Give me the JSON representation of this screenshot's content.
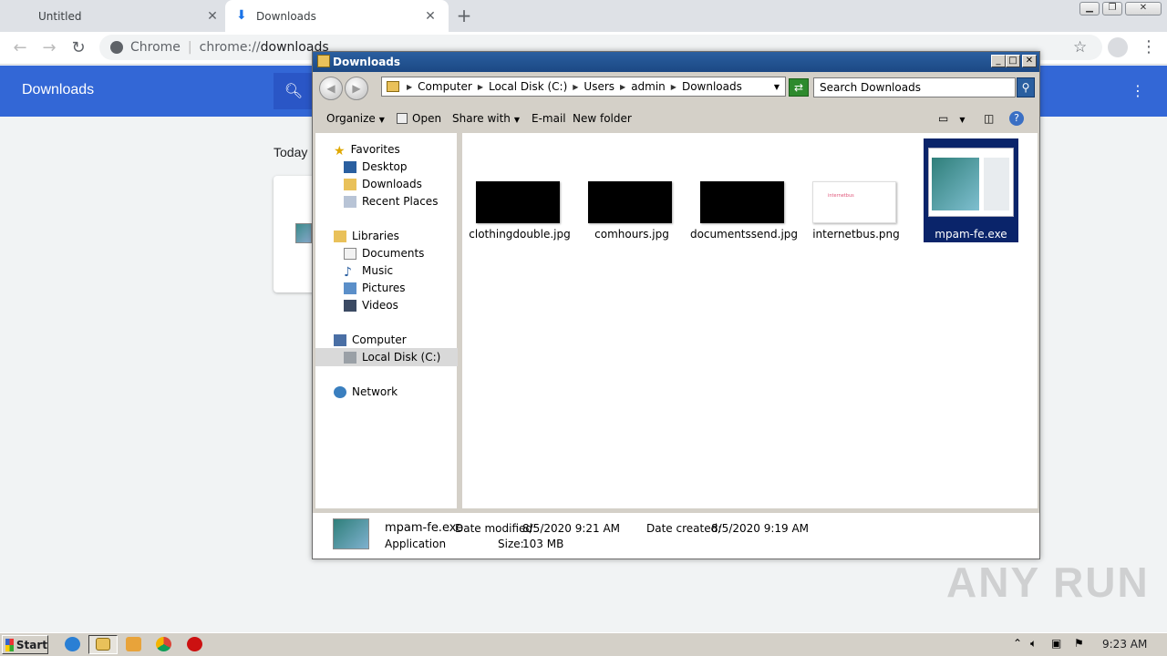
{
  "chrome": {
    "tabs": [
      {
        "title": "Untitled"
      },
      {
        "title": "Downloads"
      }
    ],
    "omnibox": {
      "chip": "Chrome",
      "url_scheme": "chrome://",
      "url_path": "downloads"
    },
    "page": {
      "header_title": "Downloads",
      "section_label": "Today"
    }
  },
  "explorer": {
    "title": "Downloads",
    "breadcrumb": [
      "Computer",
      "Local Disk (C:)",
      "Users",
      "admin",
      "Downloads"
    ],
    "search_placeholder": "Search Downloads",
    "commands": {
      "organize": "Organize",
      "open": "Open",
      "share_with": "Share with",
      "email": "E-mail",
      "new_folder": "New folder"
    },
    "nav": {
      "favorites": "Favorites",
      "desktop": "Desktop",
      "downloads": "Downloads",
      "recent_places": "Recent Places",
      "libraries": "Libraries",
      "documents": "Documents",
      "music": "Music",
      "pictures": "Pictures",
      "videos": "Videos",
      "computer": "Computer",
      "local_disk": "Local Disk (C:)",
      "network": "Network"
    },
    "files": [
      {
        "name": "clothingdouble.jpg"
      },
      {
        "name": "comhours.jpg"
      },
      {
        "name": "documentssend.jpg"
      },
      {
        "name": "internetbus.png",
        "thumb_text": "internetbus"
      },
      {
        "name": "mpam-fe.exe"
      }
    ],
    "details": {
      "name": "mpam-fe.exe",
      "type": "Application",
      "date_modified_label": "Date modified:",
      "date_modified": "8/5/2020 9:21 AM",
      "size_label": "Size:",
      "size": "103 MB",
      "date_created_label": "Date created:",
      "date_created": "8/5/2020 9:19 AM"
    }
  },
  "taskbar": {
    "start_label": "Start",
    "clock": "9:23 AM"
  },
  "watermark": "ANY RUN",
  "colors": {
    "chrome_header": "#3367d6",
    "selection": "#0a246a"
  }
}
